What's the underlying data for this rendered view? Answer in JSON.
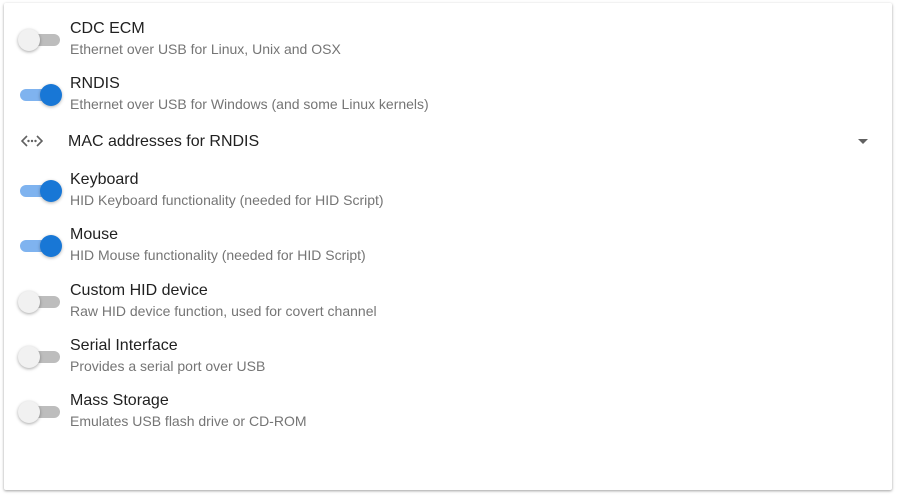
{
  "functions": [
    {
      "title": "CDC ECM",
      "subtitle": "Ethernet over USB for Linux, Unix and OSX",
      "enabled": false
    },
    {
      "title": "RNDIS",
      "subtitle": "Ethernet over USB for Windows (and some Linux kernels)",
      "enabled": true
    },
    {
      "title": "Keyboard",
      "subtitle": "HID Keyboard functionality (needed for HID Script)",
      "enabled": true
    },
    {
      "title": "Mouse",
      "subtitle": "HID Mouse functionality (needed for HID Script)",
      "enabled": true
    },
    {
      "title": "Custom HID device",
      "subtitle": "Raw HID device function, used for covert channel",
      "enabled": false
    },
    {
      "title": "Serial Interface",
      "subtitle": "Provides a serial port over USB",
      "enabled": false
    },
    {
      "title": "Mass Storage",
      "subtitle": "Emulates USB flash drive or CD-ROM",
      "enabled": false
    }
  ],
  "mac_expander": {
    "label": "MAC addresses for RNDIS",
    "icon": "settings-ethernet-icon",
    "expand_icon": "caret-down-icon"
  },
  "colors": {
    "toggle_on_thumb": "#1877d6",
    "toggle_on_track": "#7fb3ef",
    "toggle_off_thumb": "#f1f1f1",
    "toggle_off_track": "#bdbdbd"
  }
}
